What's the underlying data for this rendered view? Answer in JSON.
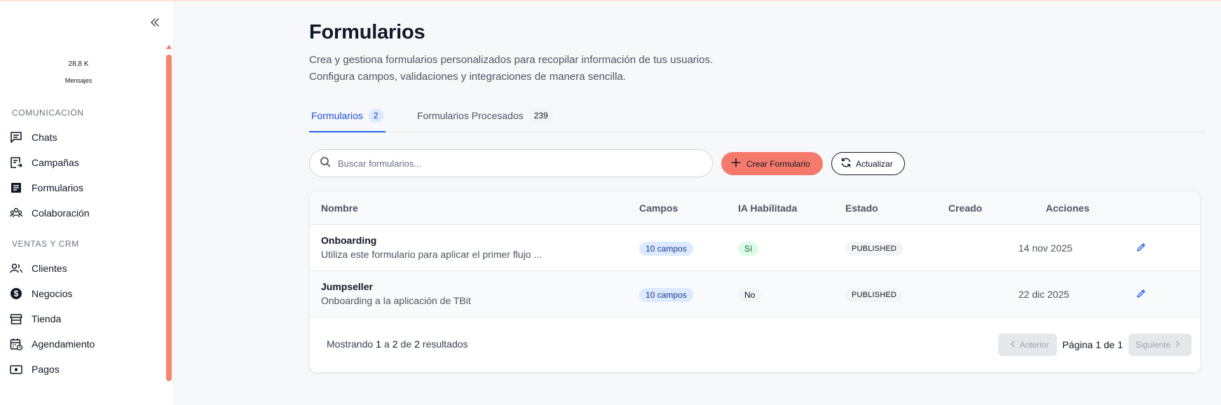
{
  "sidebar": {
    "stats": {
      "value": "28,8 K",
      "label": "Mensajes"
    },
    "sections": [
      {
        "title": "COMUNICACIÓN",
        "items": [
          {
            "label": "Chats",
            "icon": "chat-icon"
          },
          {
            "label": "Campañas",
            "icon": "campaign-icon"
          },
          {
            "label": "Formularios",
            "icon": "form-icon"
          },
          {
            "label": "Colaboración",
            "icon": "team-icon"
          }
        ]
      },
      {
        "title": "VENTAS Y CRM",
        "items": [
          {
            "label": "Clientes",
            "icon": "users-icon"
          },
          {
            "label": "Negocios",
            "icon": "dollar-icon"
          },
          {
            "label": "Tienda",
            "icon": "store-icon"
          },
          {
            "label": "Agendamiento",
            "icon": "calendar-icon"
          },
          {
            "label": "Pagos",
            "icon": "payment-icon"
          }
        ]
      }
    ]
  },
  "main": {
    "title": "Formularios",
    "description_line1": "Crea y gestiona formularios personalizados para recopilar información de tus usuarios.",
    "description_line2": "Configura campos, validaciones y integraciones de manera sencilla.",
    "tabs": [
      {
        "label": "Formularios",
        "count": "2",
        "active": true
      },
      {
        "label": "Formularios Procesados",
        "count": "239",
        "active": false
      }
    ],
    "search": {
      "placeholder": "Buscar formularios...",
      "value": ""
    },
    "create_button": "Crear Formulario",
    "refresh_button": "Actualizar",
    "table": {
      "headers": {
        "name": "Nombre",
        "fields": "Campos",
        "ai": "IA Habilitada",
        "status": "Estado",
        "created": "Creado",
        "actions": "Acciones"
      },
      "rows": [
        {
          "name": "Onboarding",
          "description": "Utiliza este formulario para aplicar el primer flujo ...",
          "fields": "10 campos",
          "ai": "Sí",
          "status": "PUBLISHED",
          "created": "14 nov 2025"
        },
        {
          "name": "Jumpseller",
          "description": "Onboarding a la aplicación de TBit",
          "fields": "10 campos",
          "ai": "No",
          "status": "PUBLISHED",
          "created": "22 dic 2025"
        }
      ]
    },
    "footer": {
      "showing": "Mostrando",
      "from": "1",
      "a": "a",
      "to": "2",
      "de": "de",
      "total": "2",
      "results": "resultados",
      "prev": "Anterior",
      "next": "Siguiente",
      "page_label": "Página 1 de 1"
    }
  },
  "colors": {
    "accent": "#f67a6b",
    "primary_blue": "#2563eb",
    "scrollbar": "#f58471"
  }
}
